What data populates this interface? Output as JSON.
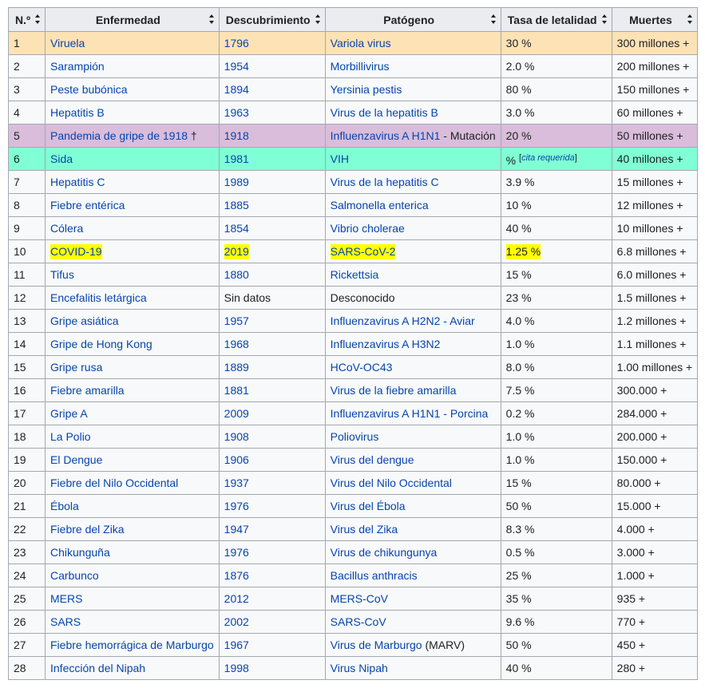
{
  "headers": {
    "n": "N.º",
    "disease": "Enfermedad",
    "discovery": "Descubrimiento",
    "pathogen": "Patógeno",
    "lethality": "Tasa de letalidad",
    "deaths": "Muertes"
  },
  "colors": {
    "link": "#0645ad",
    "row_highlight_orange": "#fde2b6",
    "row_highlight_purple": "#d9bddb",
    "row_highlight_green": "#80ffd4",
    "text_highlight_yellow": "#ffff00",
    "header_bg": "#eaecf0",
    "cell_bg": "#f8f9fa",
    "border": "#a2a9b1"
  },
  "rows": [
    {
      "n": "1",
      "disease": "Viruela",
      "year": "1796",
      "pathogen": "Variola virus",
      "pathogen_suffix": "",
      "rate": "30 %",
      "deaths": "300 millones +"
    },
    {
      "n": "2",
      "disease": "Sarampión",
      "year": "1954",
      "pathogen": "Morbillivirus",
      "pathogen_suffix": "",
      "rate": "2.0 %",
      "deaths": "200 millones +"
    },
    {
      "n": "3",
      "disease": "Peste bubónica",
      "year": "1894",
      "pathogen": "Yersinia pestis",
      "pathogen_suffix": "",
      "rate": "80 %",
      "deaths": "150 millones +"
    },
    {
      "n": "4",
      "disease": "Hepatitis B",
      "year": "1963",
      "pathogen": "Virus de la hepatitis B",
      "pathogen_suffix": "",
      "rate": "3.0 %",
      "deaths": "60 millones +"
    },
    {
      "n": "5",
      "disease": "Pandemia de gripe de 1918",
      "disease_suffix": " †",
      "year": "1918",
      "pathogen": "Influenzavirus A H1N1",
      "pathogen_suffix": " - Mutación",
      "rate": "20 %",
      "deaths": "50 millones +"
    },
    {
      "n": "6",
      "disease": "Sida",
      "year": "1981",
      "pathogen": "VIH",
      "pathogen_suffix": "",
      "rate": "%",
      "rate_cite": "cita requerida",
      "deaths": "40 millones +"
    },
    {
      "n": "7",
      "disease": "Hepatitis C",
      "year": "1989",
      "pathogen": "Virus de la hepatitis C",
      "pathogen_suffix": "",
      "rate": "3.9 %",
      "deaths": "15 millones +"
    },
    {
      "n": "8",
      "disease": "Fiebre entérica",
      "year": "1885",
      "pathogen": "Salmonella enterica",
      "pathogen_suffix": "",
      "rate": "10 %",
      "deaths": "12 millones +"
    },
    {
      "n": "9",
      "disease": "Cólera",
      "year": "1854",
      "pathogen": "Vibrio cholerae",
      "pathogen_suffix": "",
      "rate": "40 %",
      "deaths": "10 millones +"
    },
    {
      "n": "10",
      "disease": "COVID-19",
      "year": "2019",
      "pathogen": "SARS-CoV-2",
      "pathogen_suffix": "",
      "rate": "1.25 %",
      "deaths": "6.8 millones +"
    },
    {
      "n": "11",
      "disease": "Tifus",
      "year": "1880",
      "pathogen": "Rickettsia",
      "pathogen_suffix": "",
      "rate": "15 %",
      "deaths": "6.0 millones +"
    },
    {
      "n": "12",
      "disease": "Encefalitis letárgica",
      "year": "Sin datos",
      "pathogen": "Desconocido",
      "pathogen_suffix": "",
      "rate": "23 %",
      "deaths": "1.5 millones +"
    },
    {
      "n": "13",
      "disease": "Gripe asiática",
      "year": "1957",
      "pathogen": "Influenzavirus A H2N2 - Aviar",
      "pathogen_suffix": "",
      "rate": "4.0 %",
      "deaths": "1.2 millones +"
    },
    {
      "n": "14",
      "disease": "Gripe de Hong Kong",
      "year": "1968",
      "pathogen": "Influenzavirus A H3N2",
      "pathogen_suffix": "",
      "rate": "1.0 %",
      "deaths": "1.1 millones +"
    },
    {
      "n": "15",
      "disease": "Gripe rusa",
      "year": "1889",
      "pathogen": "HCoV-OC43",
      "pathogen_suffix": "",
      "rate": "8.0 %",
      "deaths": "1.00 millones +"
    },
    {
      "n": "16",
      "disease": "Fiebre amarilla",
      "year": "1881",
      "pathogen": "Virus de la fiebre amarilla",
      "pathogen_suffix": "",
      "rate": "7.5 %",
      "deaths": "300.000 +"
    },
    {
      "n": "17",
      "disease": "Gripe A",
      "year": "2009",
      "pathogen": "Influenzavirus A H1N1 - Porcina",
      "pathogen_suffix": "",
      "rate": "0.2 %",
      "deaths": "284.000 +"
    },
    {
      "n": "18",
      "disease": "La Polio",
      "year": "1908",
      "pathogen": "Poliovirus",
      "pathogen_suffix": "",
      "rate": "1.0 %",
      "deaths": "200.000 +"
    },
    {
      "n": "19",
      "disease": "El Dengue",
      "year": "1906",
      "pathogen": "Virus del dengue",
      "pathogen_suffix": "",
      "rate": "1.0 %",
      "deaths": "150.000 +"
    },
    {
      "n": "20",
      "disease": "Fiebre del Nilo Occidental",
      "year": "1937",
      "pathogen": "Virus del Nilo Occidental",
      "pathogen_suffix": "",
      "rate": "15 %",
      "deaths": "80.000 +"
    },
    {
      "n": "21",
      "disease": "Ébola",
      "year": "1976",
      "pathogen": "Virus del Ébola",
      "pathogen_suffix": "",
      "rate": "50 %",
      "deaths": "15.000 +"
    },
    {
      "n": "22",
      "disease": "Fiebre del Zika",
      "year": "1947",
      "pathogen": "Virus del Zika",
      "pathogen_suffix": "",
      "rate": "8.3 %",
      "deaths": "4.000 +"
    },
    {
      "n": "23",
      "disease": "Chikunguña",
      "year": "1976",
      "pathogen": "Virus de chikungunya",
      "pathogen_suffix": "",
      "rate": "0.5 %",
      "deaths": "3.000 +"
    },
    {
      "n": "24",
      "disease": "Carbunco",
      "year": "1876",
      "pathogen": "Bacillus anthracis",
      "pathogen_suffix": "",
      "rate": "25 %",
      "deaths": "1.000 +"
    },
    {
      "n": "25",
      "disease": "MERS",
      "year": "2012",
      "pathogen": "MERS-CoV",
      "pathogen_suffix": "",
      "rate": "35 %",
      "deaths": "935 +"
    },
    {
      "n": "26",
      "disease": "SARS",
      "year": "2002",
      "pathogen": "SARS-CoV",
      "pathogen_suffix": "",
      "rate": "9.6 %",
      "deaths": "770 +"
    },
    {
      "n": "27",
      "disease": "Fiebre hemorrágica de Marburgo",
      "year": "1967",
      "pathogen": "Virus de Marburgo",
      "pathogen_suffix": " (MARV)",
      "rate": "50 %",
      "deaths": "450 +"
    },
    {
      "n": "28",
      "disease": "Infección del Nipah",
      "year": "1998",
      "pathogen": "Virus Nipah",
      "pathogen_suffix": "",
      "rate": "40 %",
      "deaths": "280 +"
    }
  ]
}
